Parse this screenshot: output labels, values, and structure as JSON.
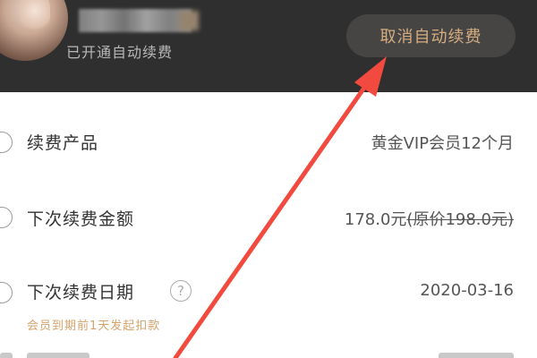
{
  "header": {
    "status": "已开通自动续费",
    "cancel_button": "取消自动续费"
  },
  "rows": [
    {
      "label": "续费产品",
      "value": "黄金VIP会员12个月"
    },
    {
      "label": "下次续费金额",
      "value": "178.0元",
      "value_original": "(原价198.0元)"
    },
    {
      "label": "下次续费日期",
      "value": "2020-03-16",
      "note": "会员到期前1天发起扣款"
    }
  ],
  "help_icon": "?",
  "colors": {
    "header_bg": "#2f2f2f",
    "button_bg": "#474543",
    "button_text": "#d5ad80",
    "note_text": "#d6a36b",
    "arrow": "#f24a3f"
  }
}
